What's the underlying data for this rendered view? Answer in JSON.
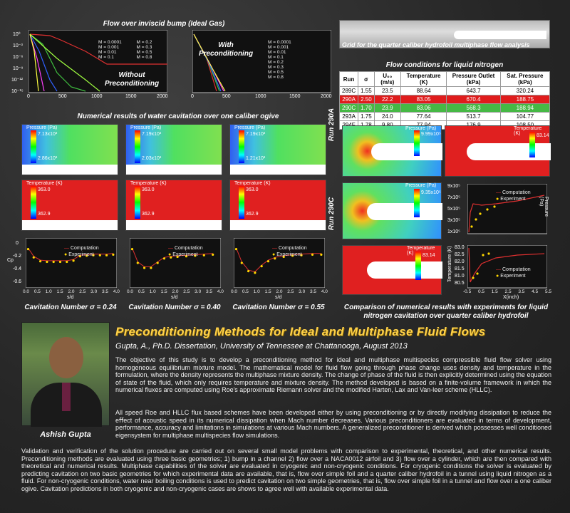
{
  "top_plots": {
    "title": "Flow over inviscid bump (Ideal Gas)",
    "left_label_1": "Without",
    "left_label_2": "Preconditioning",
    "right_label_1": "With",
    "right_label_2": "Preconditioning",
    "yticks": [
      "10⁰",
      "10⁻³",
      "10⁻⁶",
      "10⁻⁹",
      "10⁻¹²",
      "10⁻¹⁵"
    ],
    "xticks": [
      "0",
      "500",
      "1000",
      "1500",
      "2000"
    ],
    "legend_left": [
      "M = 0.0001",
      "M = 0.001",
      "M = 0.01",
      "M = 0.1",
      "M = 0.2",
      "M = 0.3",
      "M = 0.5",
      "M = 0.8"
    ],
    "legend_right": [
      "M = 0.0001",
      "M = 0.001",
      "M = 0.01",
      "M = 0.1",
      "M = 0.2",
      "M = 0.3",
      "M = 0.5",
      "M = 0.8"
    ]
  },
  "grid": {
    "caption": "Grid for the quarter caliber hydrofoil multiphase flow analysis"
  },
  "nitrogen_table": {
    "title": "Flow conditions for liquid nitrogen",
    "headers": [
      "Run",
      "σ",
      "U₀₀ (m/s)",
      "Temperature (K)",
      "Pressure Outlet (kPa)",
      "Sat. Pressure (kPa)"
    ],
    "rows": [
      [
        "289C",
        "1.55",
        "23.5",
        "88.64",
        "643.7",
        "320.24"
      ],
      [
        "290A",
        "2.50",
        "22.2",
        "83.05",
        "670.4",
        "188.75"
      ],
      [
        "290C",
        "1.70",
        "23.9",
        "83.06",
        "568.3",
        "188.94"
      ],
      [
        "293A",
        "1.75",
        "24.0",
        "77.64",
        "513.7",
        "104.77"
      ],
      [
        "294F",
        "1.78",
        "9.80",
        "77.94",
        "176.9",
        "108.50"
      ]
    ],
    "row_colors": [
      "#ffffff",
      "#e01c1c",
      "#46b845",
      "#ffffff",
      "#ffffff"
    ]
  },
  "ogive": {
    "title": "Numerical results of water cavitation over one caliber ogive",
    "pressure_label": "Pressure (Pa)",
    "temperature_label": "Temperature (K)",
    "p_max": [
      "7.13x10³",
      "7.19x10³",
      "7.19x10³"
    ],
    "p_min": [
      "2.86x10³",
      "2.03x10³",
      "1.21x10³"
    ],
    "t_max": "363.0",
    "t_min": "362.9",
    "captions": [
      "Cavitation Number σ = 0.24",
      "Cavitation Number σ = 0.40",
      "Cavitation Number σ = 0.55"
    ],
    "cp_legend": [
      "Computation",
      "Experiment"
    ],
    "cp_yticks": [
      "0",
      "-0.2",
      "-0.4",
      "-0.6"
    ],
    "cp_xticks": [
      "0.0",
      "0.5",
      "1.0",
      "1.5",
      "2.0",
      "2.5",
      "3.0",
      "3.5",
      "4.0"
    ],
    "xlabel": "s/d",
    "ylabel": "Cp"
  },
  "hydrofoil": {
    "run_a": "Run 290A",
    "run_c": "Run 290C",
    "pressure_label": "Pressure (Pa)",
    "temperature_label": "Temperature (K)",
    "a_p_max": "9.99x10⁵",
    "a_p_min": "1.87x10⁵",
    "a_t_max": "83.14",
    "a_t_min": "82.94",
    "c_p_max": "9.35x10⁵",
    "c_p_min": "1.86x10⁵",
    "c_t_max": "83.14",
    "c_t_min": "82.91",
    "caption": "Comparison of numerical results with experiments for liquid nitrogen cavitation over quarter caliber hydrofoil",
    "p_yticks": [
      "9x10⁵",
      "7x10⁵",
      "5x10⁵",
      "3x10⁵",
      "1x10⁵"
    ],
    "t_yticks": [
      "83.0",
      "82.5",
      "82.0",
      "81.5",
      "81.0",
      "80.5"
    ],
    "xticks": [
      "-0.5",
      "0.0",
      "0.5",
      "1.0",
      "1.5",
      "2.0",
      "2.5",
      "3.0",
      "3.5",
      "4.0",
      "4.5",
      "5.0",
      "5.5"
    ],
    "xlabel": "X(inch)",
    "p_ylabel": "Pressure (Pa)",
    "t_ylabel": "Temperature (K)",
    "legend": [
      "Computation",
      "Experiment"
    ]
  },
  "dissertation": {
    "title": "Preconditioning Methods for Ideal and Multiphase Fluid Flows",
    "author_line": "Gupta, A., Ph.D. Dissertation, University of Tennessee at Chattanooga, August 2013",
    "photo_caption": "Ashish Gupta",
    "para1": "The objective of this study is to develop a preconditioning method for ideal and multiphase multispecies compressible fluid flow solver using homogeneous equilibrium mixture model. The mathematical model for fluid flow going through phase change uses density and temperature in the formulation, where the density represents the multiphase mixture density. The change of phase of the fluid is then explicitly determined using the equation of state of the fluid, which only requires temperature and mixture density. The method developed is based on a finite-volume framework in which the numerical fluxes are computed using Roe's approximate Riemann solver and the modified Harten, Lax and Van-leer scheme (HLLC).",
    "para2": "All speed Roe and HLLC flux based schemes have been developed either by using preconditioning or by directly modifying dissipation to reduce the eﬀect of acoustic speed in its numerical dissipation when Mach number decreases. Various preconditioners are evaluated in terms of development, performance, accuracy and limitations in simulations at various Mach numbers. A generalized preconditioner is derived which possesses well conditioned eigensystem for multiphase multispecies flow simulations.",
    "para3": "Validation and verification of the solution procedure are carried out on several small model problems with comparison to experimental, theoretical, and other numerical results. Preconditioning methods are evaluated using three basic geometries; 1) bump in a channel 2) flow over a NACA0012 airfoil and 3) flow over a cylinder, which are then compared with theoretical and numerical results. Multiphase capabilities of the solver are evaluated in cryogenic and non-cryogenic conditions. For cryogenic conditions the solver is evaluated by predicting cavitation on two basic geometries for which experimental data are available, that is, flow over simple foil and a quarter caliber hydrofoil in a tunnel using liquid nitrogen as a fluid. For non-cryogenic conditions, water near boiling conditions is used to predict cavitation on two simple geometries, that is, flow over simple foil in a tunnel and flow over a one caliber ogive. Cavitation predictions in both cryogenic and non-cryogenic cases are shows to agree well with available experimental data."
  }
}
